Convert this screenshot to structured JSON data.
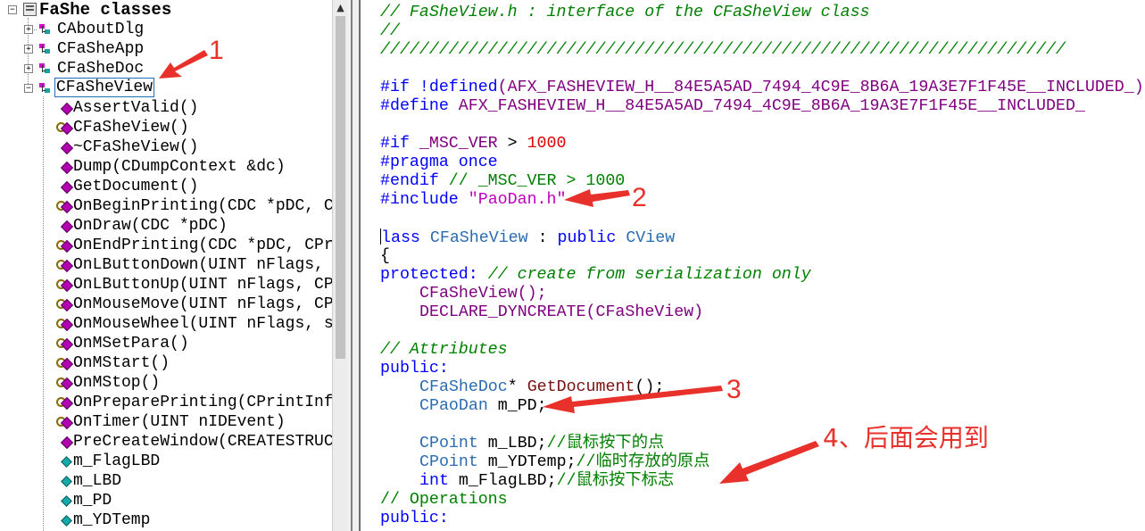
{
  "tree": {
    "root": "FaShe classes",
    "classes": [
      "CAboutDlg",
      "CFaSheApp",
      "CFaSheDoc",
      "CFaSheView"
    ],
    "members": [
      {
        "label": "AssertValid()",
        "kind": "method"
      },
      {
        "label": "CFaSheView()",
        "kind": "protected-method"
      },
      {
        "label": "~CFaSheView()",
        "kind": "method"
      },
      {
        "label": "Dump(CDumpContext &dc)",
        "kind": "method"
      },
      {
        "label": "GetDocument()",
        "kind": "method"
      },
      {
        "label": "OnBeginPrinting(CDC *pDC, C",
        "kind": "protected-method"
      },
      {
        "label": "OnDraw(CDC *pDC)",
        "kind": "method"
      },
      {
        "label": "OnEndPrinting(CDC *pDC, CPr",
        "kind": "protected-method"
      },
      {
        "label": "OnLButtonDown(UINT nFlags, ",
        "kind": "protected-method"
      },
      {
        "label": "OnLButtonUp(UINT nFlags, CP",
        "kind": "protected-method"
      },
      {
        "label": "OnMouseMove(UINT nFlags, CP",
        "kind": "protected-method"
      },
      {
        "label": "OnMouseWheel(UINT nFlags, s",
        "kind": "protected-method"
      },
      {
        "label": "OnMSetPara()",
        "kind": "protected-method"
      },
      {
        "label": "OnMStart()",
        "kind": "protected-method"
      },
      {
        "label": "OnMStop()",
        "kind": "protected-method"
      },
      {
        "label": "OnPreparePrinting(CPrintInf",
        "kind": "protected-method"
      },
      {
        "label": "OnTimer(UINT nIDEvent)",
        "kind": "protected-method"
      },
      {
        "label": "PreCreateWindow(CREATESTRUC",
        "kind": "method"
      },
      {
        "label": "m_FlagLBD",
        "kind": "variable"
      },
      {
        "label": "m_LBD",
        "kind": "variable"
      },
      {
        "label": "m_PD",
        "kind": "variable"
      },
      {
        "label": "m_YDTemp",
        "kind": "variable"
      }
    ]
  },
  "code": {
    "l1": "// FaSheView.h : interface of the CFaSheView class",
    "l2": "//",
    "l3": "//////////////////////////////////////////////////////////////////////",
    "l5_kw": "#if !defined",
    "l5_mac": "(AFX_FASHEVIEW_H__84E5A5AD_7494_4C9E_8B6A_19A3E7F1F45E__INCLUDED_)",
    "l6_kw": "#define ",
    "l6_mac": "AFX_FASHEVIEW_H__84E5A5AD_7494_4C9E_8B6A_19A3E7F1F45E__INCLUDED_",
    "l8_kw": "#if ",
    "l8_mac": "_MSC_VER",
    "l8_op": " > ",
    "l8_num": "1000",
    "l9": "#pragma once",
    "l10_kw": "#endif ",
    "l10_cmt": "// _MSC_VER > 1000",
    "l11_kw": "#include ",
    "l11_str": "\"PaoDan.h\"",
    "l13_kw": "class ",
    "l13_kw_rest": "lass",
    "l13_cls": "CFaSheView",
    "l13_sep": " : ",
    "l13_pub": "public ",
    "l13_base": "CView",
    "l14": "{",
    "l15_kw": "protected:",
    "l15_cmt": " // create from serialization only",
    "l16": "CFaSheView();",
    "l17_mac": "DECLARE_DYNCREATE",
    "l17_rest": "(CFaSheView)",
    "l19": "// Attributes",
    "l20": "public:",
    "l21_cls": "CFaSheDoc",
    "l21_star": "* ",
    "l21_fn": "GetDocument",
    "l21_end": "();",
    "l22_cls": "CPaoDan",
    "l22_rest": " m_PD;",
    "l24_cls": "CPoint",
    "l24_rest": " m_LBD;",
    "l24_cmt": "//鼠标按下的点",
    "l25_cls": "CPoint",
    "l25_rest": " m_YDTemp;",
    "l25_cmt": "//临时存放的原点",
    "l26_kw": "int",
    "l26_rest": " m_FlagLBD;",
    "l26_cmt": "//鼠标按下标志",
    "l27": "// Operations",
    "l28": "public:"
  },
  "annotations": {
    "a1": "1",
    "a2": "2",
    "a3": "3",
    "a4": "4、后面会用到"
  },
  "colors": {
    "annotation": "#e8312b",
    "comment": "#008000",
    "keyword": "#0000ff",
    "macro": "#800080",
    "number": "#e00000",
    "string": "#c000c0"
  },
  "icons": {
    "root": "class-view-root-icon",
    "class": "class-icon",
    "method": "public-method-icon",
    "protected_method": "protected-method-icon",
    "variable": "member-variable-icon"
  }
}
